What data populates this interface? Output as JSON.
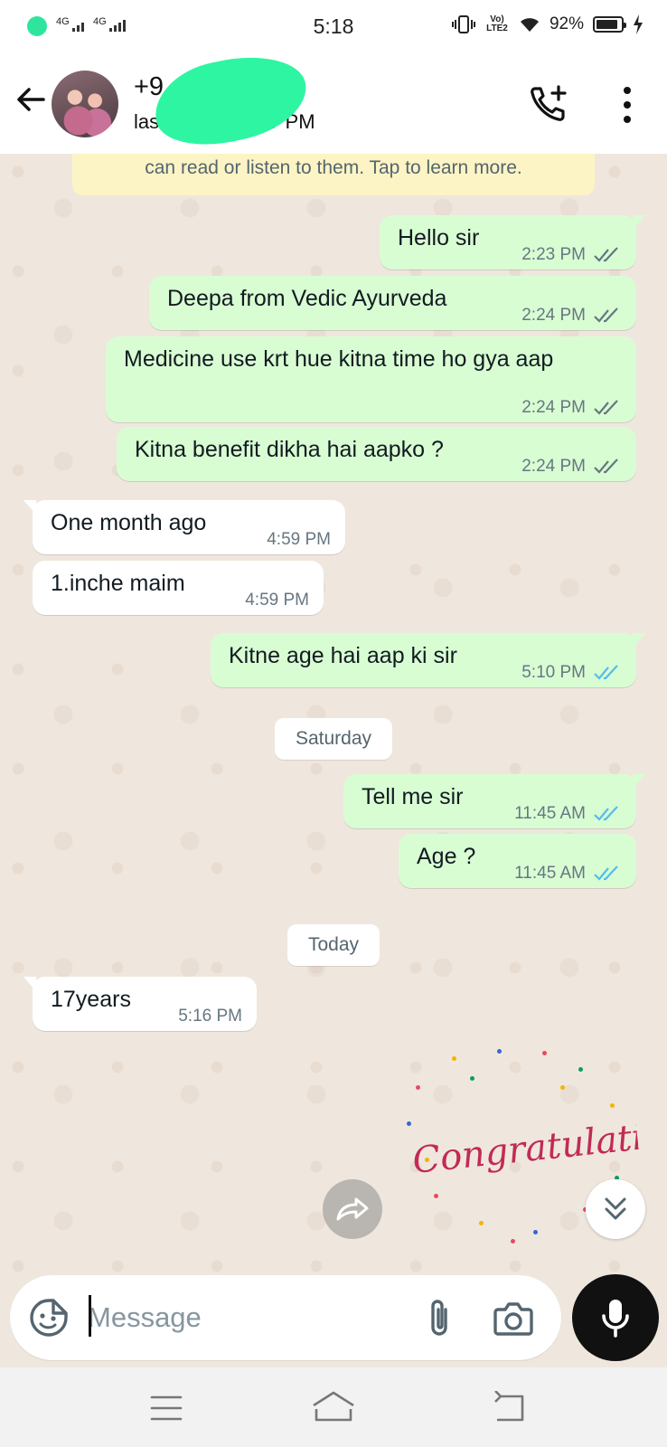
{
  "status_bar": {
    "network_1": "4G",
    "network_2": "4G",
    "time": "5:18",
    "volte": "Vo) LTE2",
    "battery": "92%"
  },
  "header": {
    "contact_name": "+9 41",
    "contact_status": "las today at 5:17 PM"
  },
  "notice": "can read or listen to them. Tap to learn more.",
  "messages": [
    {
      "dir": "out",
      "text": "Hello sir",
      "time": "2:23 PM",
      "status": "read-grey"
    },
    {
      "dir": "out",
      "text": "Deepa from Vedic Ayurveda",
      "time": "2:24 PM",
      "status": "read-grey"
    },
    {
      "dir": "out",
      "text": "Medicine use krt hue kitna time ho gya aap",
      "time": "2:24 PM",
      "status": "read-grey"
    },
    {
      "dir": "out",
      "text": "Kitna benefit dikha hai aapko ?",
      "time": "2:24 PM",
      "status": "read-grey"
    },
    {
      "dir": "in",
      "text": "One month ago",
      "time": "4:59 PM"
    },
    {
      "dir": "in",
      "text": "1.inche maim",
      "time": "4:59 PM"
    },
    {
      "dir": "out",
      "text": "Kitne age hai aap ki sir",
      "time": "5:10 PM",
      "status": "read-blue"
    },
    {
      "dir": "out",
      "text": "Tell me sir",
      "time": "11:45 AM",
      "status": "read-blue"
    },
    {
      "dir": "out",
      "text": "Age ?",
      "time": "11:45 AM",
      "status": "read-blue"
    },
    {
      "dir": "in",
      "text": "17years",
      "time": "5:16 PM"
    }
  ],
  "date_chips": [
    "Saturday",
    "Today"
  ],
  "sticker": {
    "text": "Congratulations"
  },
  "composer": {
    "placeholder": "Message"
  },
  "icons": [
    "back-arrow-icon",
    "add-call-icon",
    "more-options-icon",
    "emoji-sticker-icon",
    "paperclip-icon",
    "camera-icon",
    "microphone-icon",
    "forward-icon",
    "double-chevron-down-icon",
    "recent-apps-icon",
    "home-icon",
    "nav-back-icon"
  ],
  "colors": {
    "outgoing_bubble": "#d9fdd3",
    "incoming_bubble": "#ffffff",
    "chat_bg": "#efe7de",
    "read_tick_blue": "#53bdeb",
    "mic_button": "#111111",
    "redaction": "#2ef5a2"
  }
}
